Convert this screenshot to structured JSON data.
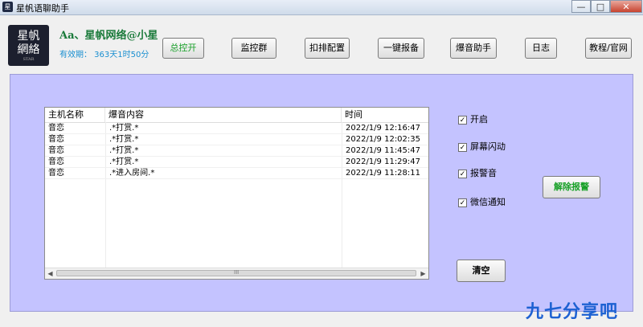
{
  "window": {
    "icon_text": "星",
    "title": "星帆语聊助手",
    "minimize": "—",
    "maximize": "□",
    "close": "✕"
  },
  "header": {
    "logo_line1": "星帆",
    "logo_line2": "網絡",
    "logo_sub": "STAR",
    "username": "Aa、星帆网络@小星",
    "validity": "有效期： 363天1时50分"
  },
  "toolbar": {
    "master_switch": "总控开",
    "monitor_group": "监控群",
    "kick_config": "扣排配置",
    "one_click_report": "一键报备",
    "burst_assistant": "爆音助手",
    "log": "日志",
    "tutorial": "教程/官网"
  },
  "table": {
    "headers": {
      "host": "主机名称",
      "content": "爆音内容",
      "time": "时间"
    },
    "rows": [
      {
        "host": "音恋",
        "content": ".*打赏.*",
        "time": "2022/1/9 12:16:47"
      },
      {
        "host": "音恋",
        "content": ".*打赏.*",
        "time": "2022/1/9 12:02:35"
      },
      {
        "host": "音恋",
        "content": ".*打赏.*",
        "time": "2022/1/9 11:45:47"
      },
      {
        "host": "音恋",
        "content": ".*打赏.*",
        "time": "2022/1/9 11:29:47"
      },
      {
        "host": "音恋",
        "content": ".*进入房间.*",
        "time": "2022/1/9 11:28:11"
      }
    ],
    "scroll_left": "◀",
    "scroll_right": "▶",
    "grip": "III"
  },
  "options": {
    "enable": {
      "label": "开启",
      "checked": true
    },
    "screen_flash": {
      "label": "屏幕闪动",
      "checked": true
    },
    "alarm_sound": {
      "label": "报警音",
      "checked": true
    },
    "wechat_notify": {
      "label": "微信通知",
      "checked": true
    },
    "check_mark": "✓"
  },
  "actions": {
    "dismiss_alarm": "解除报警",
    "clear": "清空"
  },
  "watermark": "九七分享吧"
}
